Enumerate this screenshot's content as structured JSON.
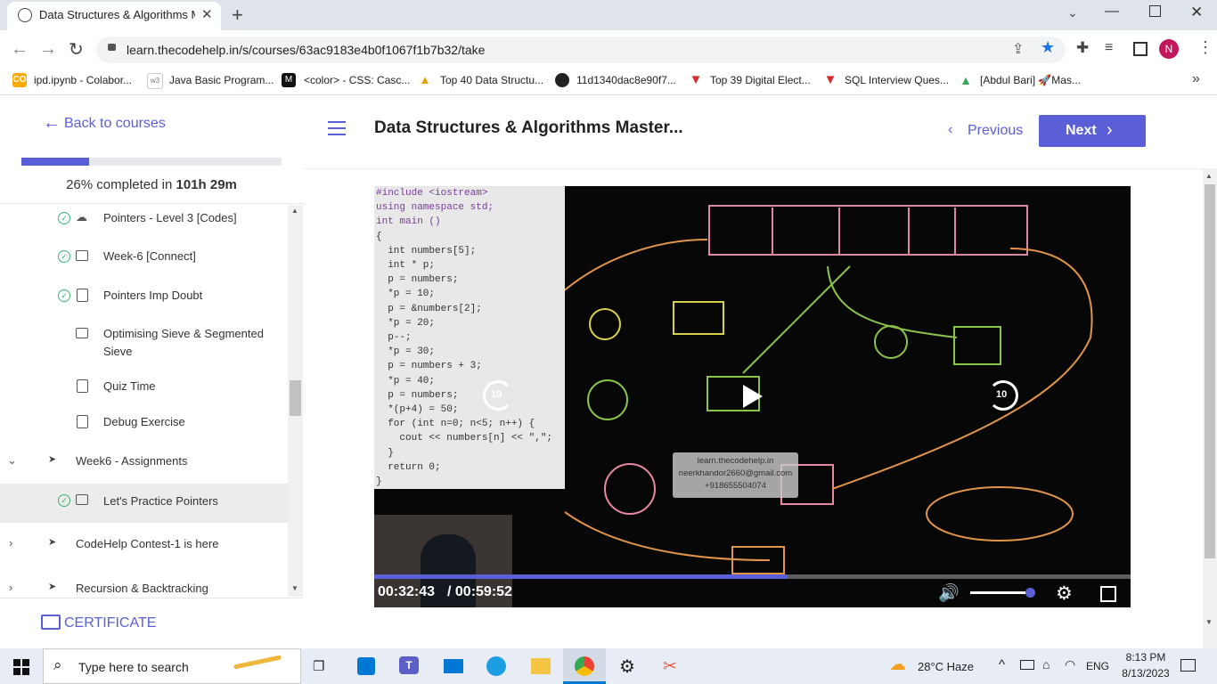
{
  "browser": {
    "tab_title": "Data Structures & Algorithms Ma",
    "url": "learn.thecodehelp.in/s/courses/63ac9183e4b0f1067f1b7b32/take",
    "profile_initial": "N",
    "bookmarks": [
      {
        "label": "ipd.ipynb - Colabor...",
        "icon": "CO"
      },
      {
        "label": "Java Basic Program...",
        "icon": "w3"
      },
      {
        "label": "<color> - CSS: Casc...",
        "icon": "M"
      },
      {
        "label": "Top 40 Data Structu...",
        "icon": "tri"
      },
      {
        "label": "11d1340dac8e90f7...",
        "icon": "gh"
      },
      {
        "label": "Top 39 Digital Elect...",
        "icon": "V"
      },
      {
        "label": "SQL Interview Ques...",
        "icon": "V"
      },
      {
        "label": "[Abdul Bari] 🚀Mas...",
        "icon": "drive"
      }
    ]
  },
  "sidebar": {
    "back_label": "Back to courses",
    "progress_percent": 26,
    "progress_text_a": "26% completed in ",
    "progress_text_b": "101h 29m",
    "items": [
      {
        "label": "Pointers - Level 3 [Codes]"
      },
      {
        "label": "Week-6 [Connect]"
      },
      {
        "label": "Pointers Imp Doubt"
      },
      {
        "label": "Optimising Sieve & Segmented",
        "label2": "Sieve"
      },
      {
        "label": "Quiz Time"
      },
      {
        "label": "Debug Exercise"
      }
    ],
    "sections": [
      {
        "label": "Week6 - Assignments"
      },
      {
        "label": "CodeHelp Contest-1 is here"
      },
      {
        "label": "Recursion & Backtracking"
      }
    ],
    "active_item": "Let's Practice Pointers",
    "certificate_label": "CERTIFICATE"
  },
  "header": {
    "course_title": "Data Structures & Algorithms Master...",
    "previous_label": "Previous",
    "next_label": "Next"
  },
  "video": {
    "current_time": "00:32:43",
    "duration": "/ 00:59:52",
    "progress_fraction": 0.546,
    "volume_fraction": 0.98,
    "skip_seconds": "10",
    "watermark": [
      "learn.thecodehelp.in",
      "neerkhandor2660@gmail.com",
      "+918655504074"
    ],
    "code_lines": [
      "#include <iostream>",
      "using namespace std;",
      "int main ()",
      "{",
      "  int numbers[5];",
      "  int * p;",
      "  p = numbers;",
      "  *p = 10;",
      "  p = &numbers[2];",
      "  *p = 20;",
      "  p--;",
      "  *p = 30;",
      "  p = numbers + 3;",
      "  *p = 40;",
      "  p = numbers;",
      "  *(p+4) = 50;",
      "  for (int n=0; n<5; n++) {",
      "    cout << numbers[n] << \",\";",
      "  }",
      "  return 0;",
      "}"
    ]
  },
  "taskbar": {
    "search_placeholder": "Type here to search",
    "weather": "28°C  Haze",
    "language": "ENG",
    "time": "8:13 PM",
    "date": "8/13/2023"
  }
}
